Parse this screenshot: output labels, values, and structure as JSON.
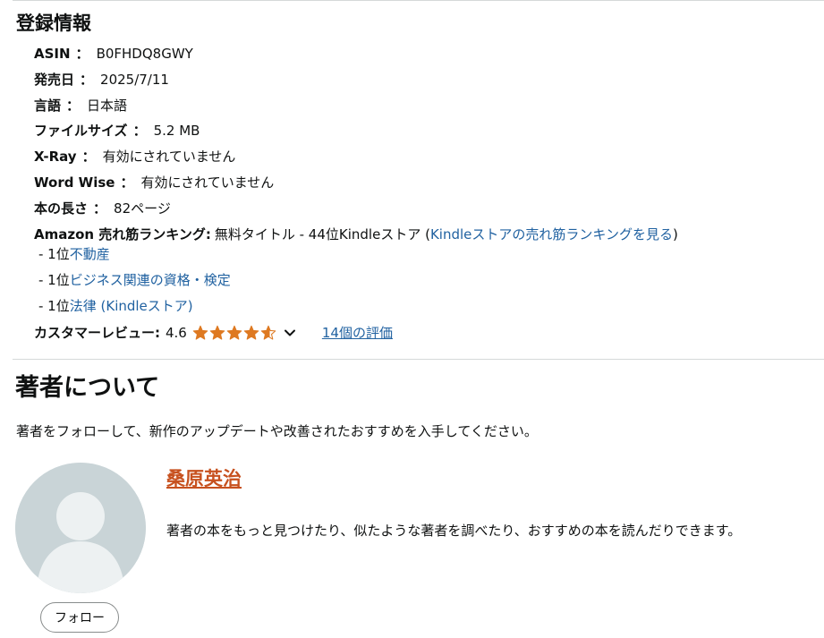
{
  "product_details": {
    "title": "登録情報",
    "rows": [
      {
        "label": "ASIN",
        "value": "B0FHDQ8GWY"
      },
      {
        "label": "発売日",
        "value": "2025/7/11"
      },
      {
        "label": "言語",
        "value": "日本語"
      },
      {
        "label": "ファイルサイズ",
        "value": "5.2 MB"
      },
      {
        "label": "X-Ray",
        "value": "有効にされていません"
      },
      {
        "label": "Word Wise",
        "value": "有効にされていません"
      },
      {
        "label": "本の長さ",
        "value": "82ページ"
      }
    ],
    "separator": "：",
    "ranking": {
      "label": "Amazon 売れ筋ランキング:",
      "text": "無料タイトル - 44位Kindleストア",
      "paren_open": "(",
      "link_text": "Kindleストアの売れ筋ランキングを見る",
      "paren_close": ")",
      "sub_ranks": [
        {
          "prefix": "- 1位",
          "link": "不動産"
        },
        {
          "prefix": "- 1位",
          "link": "ビジネス関連の資格・検定"
        },
        {
          "prefix": "- 1位",
          "link": "法律 (Kindleストア)"
        }
      ]
    },
    "reviews": {
      "label": "カスタマーレビュー:",
      "rating": "4.6",
      "rating_value": 4.6,
      "max_rating": 5,
      "star_color": "#de7921",
      "chevron_icon": "chevron-down-icon",
      "ratings_link": "14個の評価"
    }
  },
  "author_section": {
    "title": "著者について",
    "description": "著者をフォローして、新作のアップデートや改善されたおすすめを入手してください。",
    "author_name": "桑原英治",
    "author_blurb": "著者の本をもっと見つけたり、似たような著者を調べたり、おすすめの本を読んだりできます。",
    "avatar_icon": "person-placeholder-icon",
    "follow_button": "フォロー"
  },
  "colors": {
    "link": "#2162a1",
    "author_link": "#c7511f",
    "text": "#0f1111",
    "divider": "#d5d9d9",
    "avatar_bg": "#c9d4d7"
  }
}
